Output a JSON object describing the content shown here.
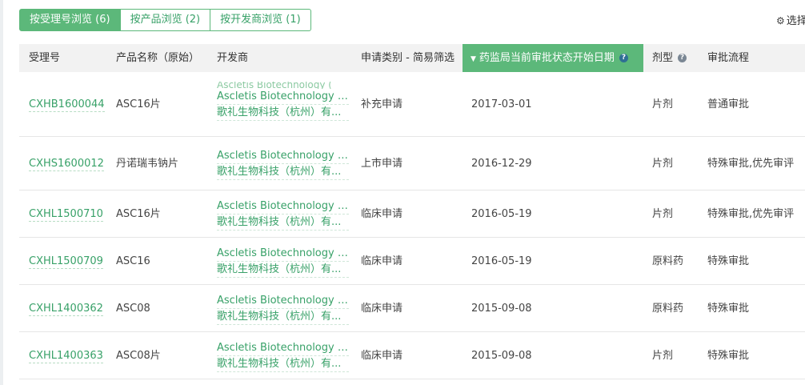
{
  "tabs": [
    {
      "label": "按受理号浏览 (6)",
      "active": true
    },
    {
      "label": "按产品浏览 (2)",
      "active": false
    },
    {
      "label": "按开发商浏览 (1)",
      "active": false
    }
  ],
  "settings_label": "选择",
  "columns": {
    "acceptance_no": "受理号",
    "product_name": "产品名称（原始）",
    "developer": "开发商",
    "application_type": "申请类别 - 简易筛选",
    "status_date": "药监局当前审批状态开始日期",
    "dosage_form": "剂型",
    "review_process": "审批流程"
  },
  "rows": [
    {
      "acceptance_no": "CXHB1600044",
      "product": "ASC16片",
      "developer_en": "Ascletis Biotechnology (...",
      "developer_cn": "歌礼生物科技（杭州）有...",
      "extra_line": "Ascletis Biotechnology (",
      "type": "补充申请",
      "date": "2017-03-01",
      "form": "片剂",
      "process": "普通审批"
    },
    {
      "acceptance_no": "CXHS1600012",
      "product": "丹诺瑞韦钠片",
      "developer_en": "Ascletis Biotechnology (...",
      "developer_cn": "歌礼生物科技（杭州）有...",
      "type": "上市申请",
      "date": "2016-12-29",
      "form": "片剂",
      "process": "特殊审批,优先审评"
    },
    {
      "acceptance_no": "CXHL1500710",
      "product": "ASC16片",
      "developer_en": "Ascletis Biotechnology (...",
      "developer_cn": "歌礼生物科技（杭州）有...",
      "type": "临床申请",
      "date": "2016-05-19",
      "form": "片剂",
      "process": "特殊审批,优先审评"
    },
    {
      "acceptance_no": "CXHL1500709",
      "product": "ASC16",
      "developer_en": "Ascletis Biotechnology (...",
      "developer_cn": "歌礼生物科技（杭州）有...",
      "type": "临床申请",
      "date": "2016-05-19",
      "form": "原料药",
      "process": "特殊审批"
    },
    {
      "acceptance_no": "CXHL1400362",
      "product": "ASC08",
      "developer_en": "Ascletis Biotechnology (...",
      "developer_cn": "歌礼生物科技（杭州）有...",
      "type": "临床申请",
      "date": "2015-09-08",
      "form": "原料药",
      "process": "特殊审批"
    },
    {
      "acceptance_no": "CXHL1400363",
      "product": "ASC08片",
      "developer_en": "Ascletis Biotechnology (...",
      "developer_cn": "歌礼生物科技（杭州）有...",
      "type": "临床申请",
      "date": "2015-09-08",
      "form": "片剂",
      "process": "特殊审批"
    }
  ]
}
